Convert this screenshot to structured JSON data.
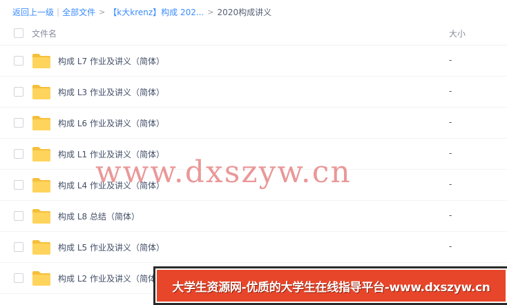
{
  "breadcrumb": {
    "back": "返回上一级",
    "divider": "|",
    "all_files": "全部文件",
    "crumb1": "【k大krenz】构成 202...",
    "current": "2020构成讲义",
    "gt": ">"
  },
  "header": {
    "name": "文件名",
    "size": "大小"
  },
  "files": [
    {
      "name": "构成 L7 作业及讲义（简体）",
      "size": "-"
    },
    {
      "name": "构成 L3 作业及讲义（简体）",
      "size": "-"
    },
    {
      "name": "构成 L6 作业及讲义（简体）",
      "size": "-"
    },
    {
      "name": "构成 L1 作业及讲义（简体）",
      "size": "-"
    },
    {
      "name": "构成 L4 作业及讲义（简体）",
      "size": "-"
    },
    {
      "name": "构成 L8 总结（简体）",
      "size": "-"
    },
    {
      "name": "构成 L5 作业及讲义（简体）",
      "size": "-"
    },
    {
      "name": "构成 L2 作业及讲义（简体）",
      "size": "-"
    }
  ],
  "icons": {
    "folder": "folder-icon",
    "folder_color": "#ffd45c"
  },
  "watermark": "www.dxszyw.cn",
  "banner": "大学生资源网-优质的大学生在线指导平台-www.dxszyw.cn",
  "colors": {
    "link": "#3b8cff",
    "banner_bg": "#e8462a"
  }
}
